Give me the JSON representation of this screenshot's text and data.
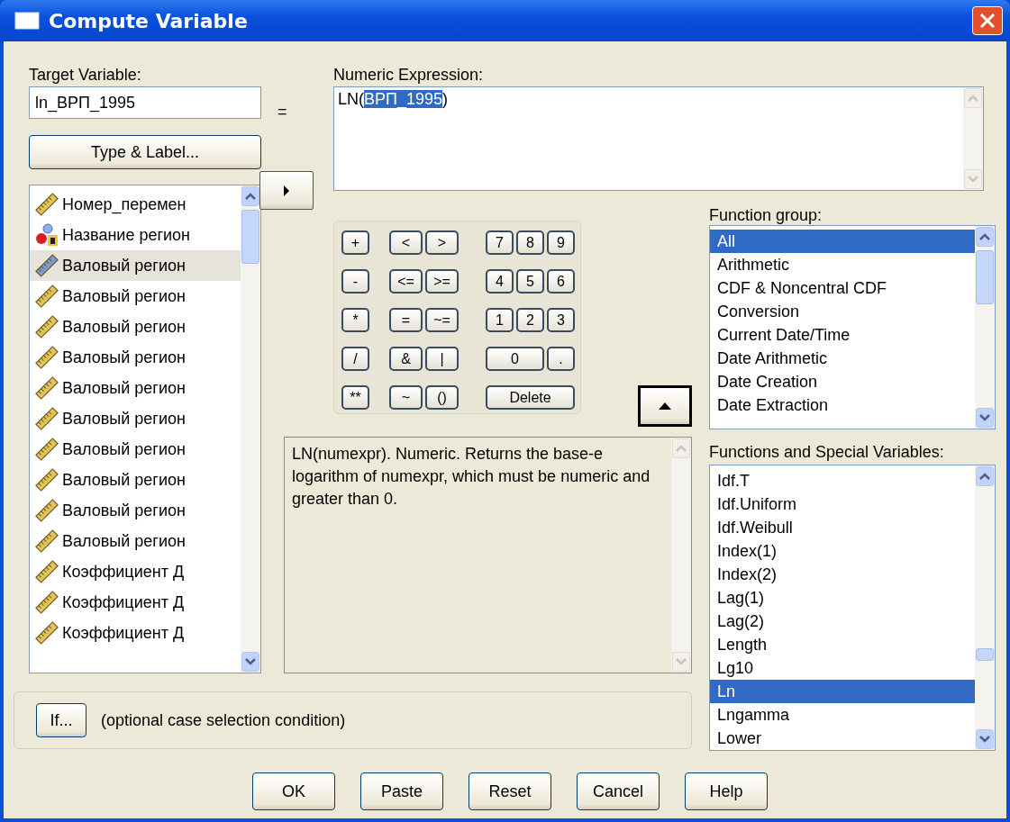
{
  "window": {
    "title": "Compute Variable"
  },
  "target_variable": {
    "label": "Target Variable:",
    "value": "ln_ВРП_1995"
  },
  "type_label_button": "Type & Label...",
  "equals_sign": "=",
  "numeric_expression": {
    "label": "Numeric Expression:",
    "before": "LN(",
    "selected": "ВРП_1995",
    "after": ")"
  },
  "variables": [
    {
      "label": "Номер_перемен",
      "kind": "scale",
      "selected": false
    },
    {
      "label": "Название регион",
      "kind": "nominal",
      "selected": false
    },
    {
      "label": "Валовый регион",
      "kind": "scale",
      "selected": true
    },
    {
      "label": "Валовый регион",
      "kind": "scale",
      "selected": false
    },
    {
      "label": "Валовый регион",
      "kind": "scale",
      "selected": false
    },
    {
      "label": "Валовый регион",
      "kind": "scale",
      "selected": false
    },
    {
      "label": "Валовый регион",
      "kind": "scale",
      "selected": false
    },
    {
      "label": "Валовый регион",
      "kind": "scale",
      "selected": false
    },
    {
      "label": "Валовый регион",
      "kind": "scale",
      "selected": false
    },
    {
      "label": "Валовый регион",
      "kind": "scale",
      "selected": false
    },
    {
      "label": "Валовый регион",
      "kind": "scale",
      "selected": false
    },
    {
      "label": "Валовый регион",
      "kind": "scale",
      "selected": false
    },
    {
      "label": "Коэффициент Д",
      "kind": "scale",
      "selected": false
    },
    {
      "label": "Коэффициент Д",
      "kind": "scale",
      "selected": false
    },
    {
      "label": "Коэффициент Д",
      "kind": "scale",
      "selected": false
    }
  ],
  "keypad": [
    {
      "keys": [
        {
          "label": "+",
          "kind": "key"
        },
        {
          "label": "<",
          "kind": "key"
        },
        {
          "label": ">",
          "kind": "key"
        },
        {
          "label": "7",
          "kind": "key"
        },
        {
          "label": "8",
          "kind": "key"
        },
        {
          "label": "9",
          "kind": "key"
        }
      ]
    },
    {
      "keys": [
        {
          "label": "-",
          "kind": "key"
        },
        {
          "label": "<=",
          "kind": "key"
        },
        {
          "label": ">=",
          "kind": "key"
        },
        {
          "label": "4",
          "kind": "key"
        },
        {
          "label": "5",
          "kind": "key"
        },
        {
          "label": "6",
          "kind": "key"
        }
      ]
    },
    {
      "keys": [
        {
          "label": "*",
          "kind": "key"
        },
        {
          "label": "=",
          "kind": "key"
        },
        {
          "label": "~=",
          "kind": "key"
        },
        {
          "label": "1",
          "kind": "key"
        },
        {
          "label": "2",
          "kind": "key"
        },
        {
          "label": "3",
          "kind": "key"
        }
      ]
    },
    {
      "keys": [
        {
          "label": "/",
          "kind": "key"
        },
        {
          "label": "&",
          "kind": "key"
        },
        {
          "label": "|",
          "kind": "key"
        },
        {
          "label": "0",
          "kind": "wide"
        },
        {
          "label": ".",
          "kind": "key"
        }
      ]
    },
    {
      "keys": [
        {
          "label": "**",
          "kind": "key"
        },
        {
          "label": "~",
          "kind": "key"
        },
        {
          "label": "()",
          "kind": "key"
        },
        {
          "label": "Delete",
          "kind": "wider"
        }
      ]
    }
  ],
  "description": "LN(numexpr). Numeric. Returns the base-e logarithm of numexpr, which must be numeric and greater than 0.",
  "function_group": {
    "label": "Function group:",
    "items": [
      {
        "label": "All",
        "selected": true
      },
      {
        "label": "Arithmetic",
        "selected": false
      },
      {
        "label": "CDF & Noncentral CDF",
        "selected": false
      },
      {
        "label": "Conversion",
        "selected": false
      },
      {
        "label": "Current Date/Time",
        "selected": false
      },
      {
        "label": "Date Arithmetic",
        "selected": false
      },
      {
        "label": "Date Creation",
        "selected": false
      },
      {
        "label": "Date Extraction",
        "selected": false
      }
    ]
  },
  "functions": {
    "label": "Functions and Special Variables:",
    "items": [
      {
        "label": "Idf.T",
        "selected": false
      },
      {
        "label": "Idf.Uniform",
        "selected": false
      },
      {
        "label": "Idf.Weibull",
        "selected": false
      },
      {
        "label": "Index(1)",
        "selected": false
      },
      {
        "label": "Index(2)",
        "selected": false
      },
      {
        "label": "Lag(1)",
        "selected": false
      },
      {
        "label": "Lag(2)",
        "selected": false
      },
      {
        "label": "Length",
        "selected": false
      },
      {
        "label": "Lg10",
        "selected": false
      },
      {
        "label": "Ln",
        "selected": true
      },
      {
        "label": "Lngamma",
        "selected": false
      },
      {
        "label": "Lower",
        "selected": false
      }
    ]
  },
  "if_button": "If...",
  "if_condition": "(optional case selection condition)",
  "buttons": [
    "OK",
    "Paste",
    "Reset",
    "Cancel",
    "Help"
  ]
}
